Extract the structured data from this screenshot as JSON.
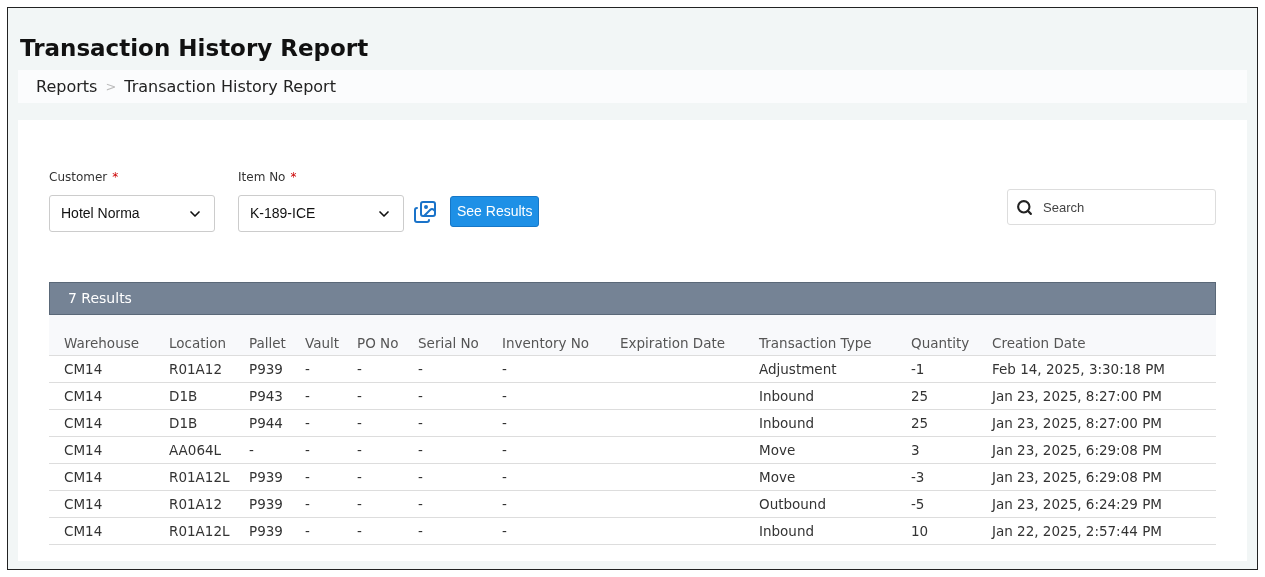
{
  "title": "Transaction History Report",
  "breadcrumb": {
    "items": [
      "Reports",
      "Transaction History Report"
    ],
    "separator": ">"
  },
  "filters": [
    {
      "label": "Customer",
      "required_mark": "*",
      "value": "Hotel Norma"
    },
    {
      "label": "Item No",
      "required_mark": "*",
      "value": "K-189-ICE"
    }
  ],
  "see_results_button": "See Results",
  "search": {
    "placeholder": "Search"
  },
  "results_header": "7 Results",
  "table": {
    "columns": [
      "Warehouse",
      "Location",
      "Pallet",
      "Vault",
      "PO No",
      "Serial No",
      "Inventory No",
      "Expiration Date",
      "Transaction Type",
      "Quantity",
      "Creation Date"
    ],
    "rows": [
      [
        "CM14",
        "R01A12",
        "P939",
        "-",
        "-",
        "-",
        "-",
        "",
        "Adjustment",
        "-1",
        "Feb 14, 2025, 3:30:18 PM"
      ],
      [
        "CM14",
        "D1B",
        "P943",
        "-",
        "-",
        "-",
        "-",
        "",
        "Inbound",
        "25",
        "Jan 23, 2025, 8:27:00 PM"
      ],
      [
        "CM14",
        "D1B",
        "P944",
        "-",
        "-",
        "-",
        "-",
        "",
        "Inbound",
        "25",
        "Jan 23, 2025, 8:27:00 PM"
      ],
      [
        "CM14",
        "AA064L",
        "-",
        "-",
        "-",
        "-",
        "-",
        "",
        "Move",
        "3",
        "Jan 23, 2025, 6:29:08 PM"
      ],
      [
        "CM14",
        "R01A12L",
        "P939",
        "-",
        "-",
        "-",
        "-",
        "",
        "Move",
        "-3",
        "Jan 23, 2025, 6:29:08 PM"
      ],
      [
        "CM14",
        "R01A12",
        "P939",
        "-",
        "-",
        "-",
        "-",
        "",
        "Outbound",
        "-5",
        "Jan 23, 2025, 6:24:29 PM"
      ],
      [
        "CM14",
        "R01A12L",
        "P939",
        "-",
        "-",
        "-",
        "-",
        "",
        "Inbound",
        "10",
        "Jan 22, 2025, 2:57:44 PM"
      ]
    ]
  }
}
